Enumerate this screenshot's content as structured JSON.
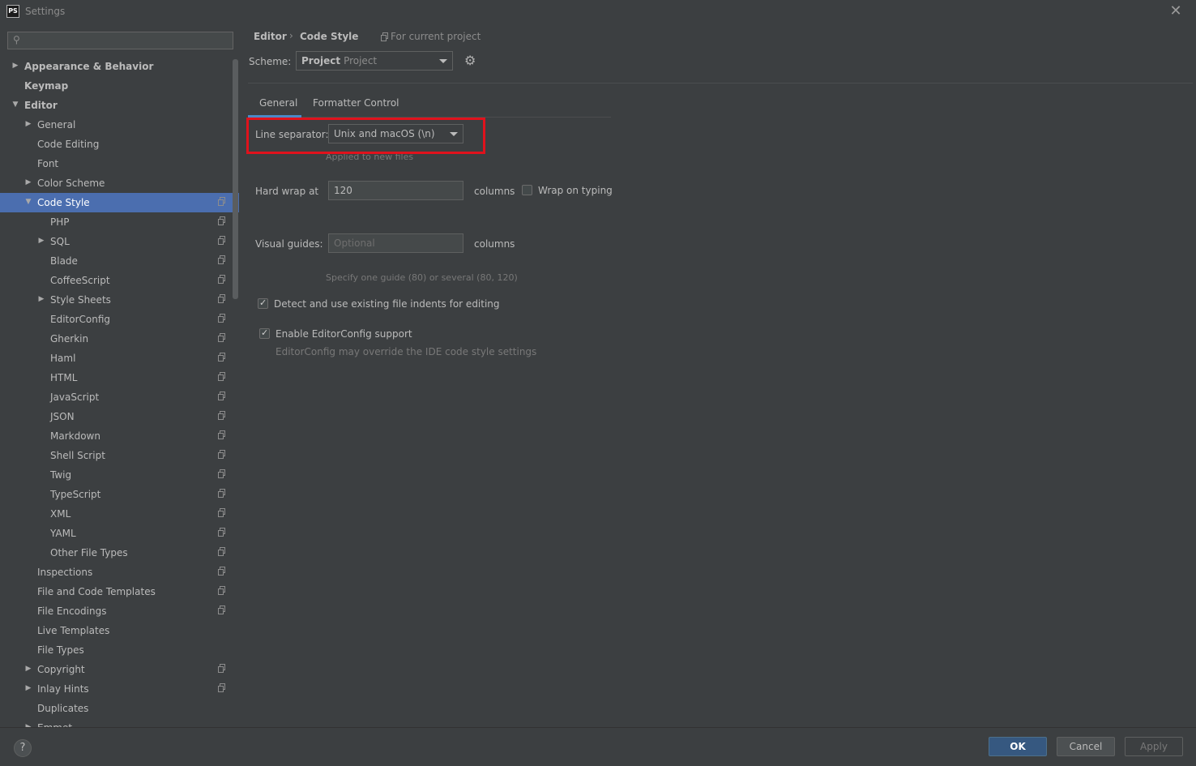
{
  "window": {
    "app_icon_text": "PS",
    "title": "Settings"
  },
  "search": {
    "placeholder": ""
  },
  "tree": [
    {
      "label": "Appearance & Behavior",
      "arrow": "▶",
      "bold": true
    },
    {
      "label": "Keymap",
      "arrow": "",
      "bold": true
    },
    {
      "label": "Editor",
      "arrow": "▼",
      "bold": true
    },
    {
      "label": "General",
      "arrow": "▶"
    },
    {
      "label": "Code Editing",
      "arrow": ""
    },
    {
      "label": "Font",
      "arrow": ""
    },
    {
      "label": "Color Scheme",
      "arrow": "▶"
    },
    {
      "label": "Code Style",
      "arrow": "▼",
      "selected": true,
      "project_icon": true
    },
    {
      "label": "PHP",
      "arrow": "",
      "project_icon": true
    },
    {
      "label": "SQL",
      "arrow": "▶",
      "project_icon": true
    },
    {
      "label": "Blade",
      "arrow": "",
      "project_icon": true
    },
    {
      "label": "CoffeeScript",
      "arrow": "",
      "project_icon": true
    },
    {
      "label": "Style Sheets",
      "arrow": "▶",
      "project_icon": true
    },
    {
      "label": "EditorConfig",
      "arrow": "",
      "project_icon": true
    },
    {
      "label": "Gherkin",
      "arrow": "",
      "project_icon": true
    },
    {
      "label": "Haml",
      "arrow": "",
      "project_icon": true
    },
    {
      "label": "HTML",
      "arrow": "",
      "project_icon": true
    },
    {
      "label": "JavaScript",
      "arrow": "",
      "project_icon": true
    },
    {
      "label": "JSON",
      "arrow": "",
      "project_icon": true
    },
    {
      "label": "Markdown",
      "arrow": "",
      "project_icon": true
    },
    {
      "label": "Shell Script",
      "arrow": "",
      "project_icon": true
    },
    {
      "label": "Twig",
      "arrow": "",
      "project_icon": true
    },
    {
      "label": "TypeScript",
      "arrow": "",
      "project_icon": true
    },
    {
      "label": "XML",
      "arrow": "",
      "project_icon": true
    },
    {
      "label": "YAML",
      "arrow": "",
      "project_icon": true
    },
    {
      "label": "Other File Types",
      "arrow": "",
      "project_icon": true
    },
    {
      "label": "Inspections",
      "arrow": "",
      "project_icon": true
    },
    {
      "label": "File and Code Templates",
      "arrow": "",
      "project_icon": true
    },
    {
      "label": "File Encodings",
      "arrow": "",
      "project_icon": true
    },
    {
      "label": "Live Templates",
      "arrow": ""
    },
    {
      "label": "File Types",
      "arrow": ""
    },
    {
      "label": "Copyright",
      "arrow": "▶",
      "project_icon": true
    },
    {
      "label": "Inlay Hints",
      "arrow": "▶",
      "project_icon": true
    },
    {
      "label": "Duplicates",
      "arrow": ""
    },
    {
      "label": "Emmet",
      "arrow": "▶"
    }
  ],
  "breadcrumb": {
    "editor": "Editor",
    "separator": "›",
    "code_style": "Code Style",
    "for_project": "For current project"
  },
  "scheme": {
    "label": "Scheme:",
    "value": "Project",
    "sub": "Project"
  },
  "tabs": {
    "general": "General",
    "formatter": "Formatter Control"
  },
  "line_separator": {
    "label": "Line separator:",
    "value": "Unix and macOS (\\n)",
    "hint": "Applied to new files"
  },
  "hard_wrap": {
    "label": "Hard wrap at",
    "value": "120",
    "unit": "columns",
    "wrap_on_typing": "Wrap on typing"
  },
  "visual_guides": {
    "label": "Visual guides:",
    "placeholder": "Optional",
    "unit": "columns",
    "hint": "Specify one guide (80) or several (80, 120)"
  },
  "detect_indents": {
    "label": "Detect and use existing file indents for editing",
    "checked": true
  },
  "editorconfig": {
    "label": "Enable EditorConfig support",
    "checked": true,
    "hint": "EditorConfig may override the IDE code style settings"
  },
  "buttons": {
    "help": "?",
    "ok": "OK",
    "cancel": "Cancel",
    "apply": "Apply"
  },
  "colors": {
    "background": "#3c3f41",
    "selection": "#4b6eaf",
    "accent": "#4a88c7",
    "highlight_box": "#e0121c",
    "ok_button": "#365880"
  }
}
